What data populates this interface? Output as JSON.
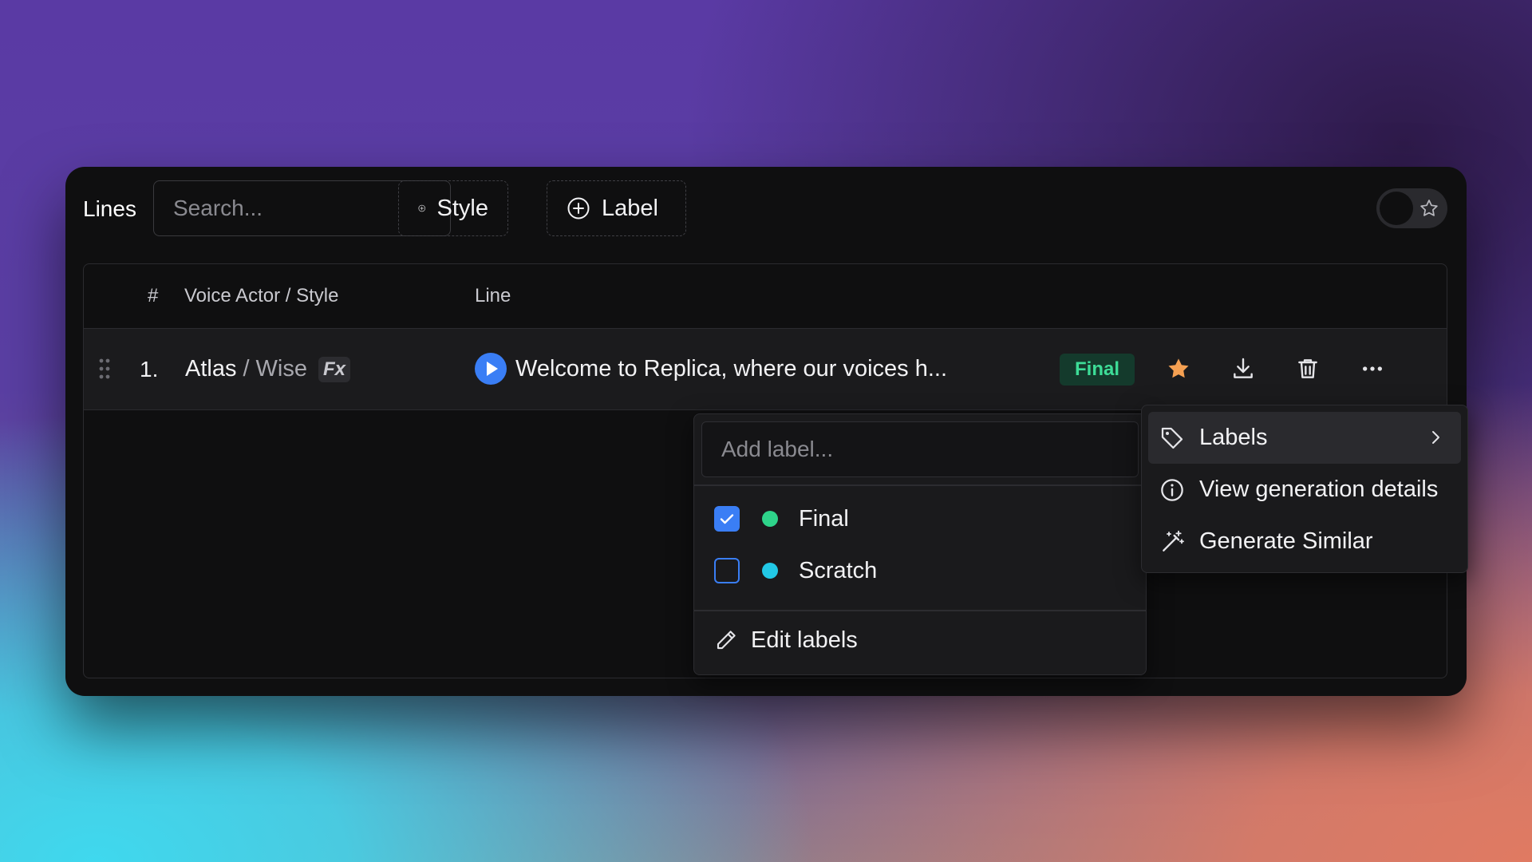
{
  "toolbar": {
    "title": "Lines",
    "search_placeholder": "Search...",
    "style_button": "Style",
    "label_button": "Label"
  },
  "table": {
    "headers": {
      "number": "#",
      "actor": "Voice Actor / Style",
      "line": "Line"
    },
    "rows": [
      {
        "number": "1.",
        "actor": "Atlas",
        "separator": "/",
        "style": "Wise",
        "fx": "Fx",
        "line": "Welcome to Replica, where our voices h...",
        "label": "Final",
        "starred": true
      }
    ]
  },
  "label_popover": {
    "placeholder": "Add label...",
    "options": [
      {
        "label": "Final",
        "checked": true,
        "color": "#2ed48a"
      },
      {
        "label": "Scratch",
        "checked": false,
        "color": "#22c8e6"
      }
    ],
    "edit_label": "Edit labels"
  },
  "context_menu": {
    "items": [
      {
        "label": "Labels",
        "icon": "tag-icon"
      },
      {
        "label": "View generation details",
        "icon": "info-icon"
      },
      {
        "label": "Generate Similar",
        "icon": "magic-wand-icon"
      }
    ]
  },
  "colors": {
    "accent": "#3a7ef5",
    "star": "#f5a052",
    "final_badge_text": "#3ddc97",
    "final_badge_bg": "#143a2c"
  }
}
